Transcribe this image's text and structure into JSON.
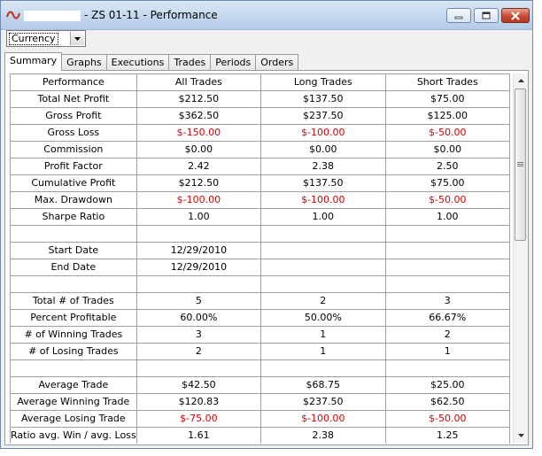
{
  "window": {
    "title": "- ZS 01-11 - Performance"
  },
  "toolbar": {
    "currency_value": "Currency"
  },
  "tabs": [
    "Summary",
    "Graphs",
    "Executions",
    "Trades",
    "Periods",
    "Orders"
  ],
  "table": {
    "headers": [
      "Performance",
      "All Trades",
      "Long Trades",
      "Short Trades"
    ],
    "rows": [
      [
        "Total Net Profit",
        "$212.50",
        "$137.50",
        "$75.00"
      ],
      [
        "Gross Profit",
        "$362.50",
        "$237.50",
        "$125.00"
      ],
      [
        "Gross Loss",
        "$-150.00",
        "$-100.00",
        "$-50.00"
      ],
      [
        "Commission",
        "$0.00",
        "$0.00",
        "$0.00"
      ],
      [
        "Profit Factor",
        "2.42",
        "2.38",
        "2.50"
      ],
      [
        "Cumulative Profit",
        "$212.50",
        "$137.50",
        "$75.00"
      ],
      [
        "Max. Drawdown",
        "$-100.00",
        "$-100.00",
        "$-50.00"
      ],
      [
        "Sharpe Ratio",
        "1.00",
        "1.00",
        "1.00"
      ],
      [
        "",
        "",
        "",
        ""
      ],
      [
        "Start Date",
        "12/29/2010",
        "",
        ""
      ],
      [
        "End Date",
        "12/29/2010",
        "",
        ""
      ],
      [
        "",
        "",
        "",
        ""
      ],
      [
        "Total # of Trades",
        "5",
        "2",
        "3"
      ],
      [
        "Percent Profitable",
        "60.00%",
        "50.00%",
        "66.67%"
      ],
      [
        "# of Winning Trades",
        "3",
        "1",
        "2"
      ],
      [
        "# of Losing Trades",
        "2",
        "1",
        "1"
      ],
      [
        "",
        "",
        "",
        ""
      ],
      [
        "Average Trade",
        "$42.50",
        "$68.75",
        "$25.00"
      ],
      [
        "Average Winning Trade",
        "$120.83",
        "$237.50",
        "$62.50"
      ],
      [
        "Average Losing Trade",
        "$-75.00",
        "$-100.00",
        "$-50.00"
      ],
      [
        "Ratio avg. Win / avg. Loss",
        "1.61",
        "2.38",
        "1.25"
      ]
    ]
  },
  "colors": {
    "negative": "#d40000"
  }
}
